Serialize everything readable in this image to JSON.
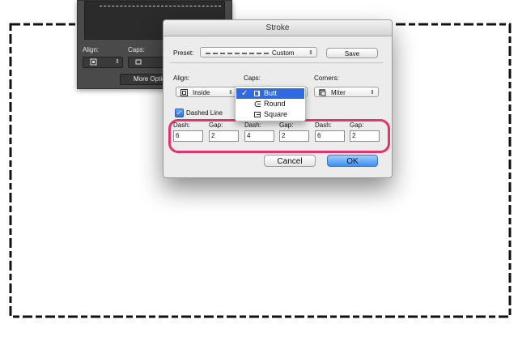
{
  "left_panel": {
    "align_label": "Align:",
    "caps_label": "Caps:",
    "more_options": "More Options"
  },
  "dialog": {
    "title": "Stroke",
    "preset_label": "Preset:",
    "preset_value": "Custom",
    "save_label": "Save",
    "align_label": "Align:",
    "align_value": "Inside",
    "caps_label": "Caps:",
    "corners_label": "Corners:",
    "corners_value": "Miter",
    "dashed_line_label": "Dashed Line",
    "dash_fields": [
      {
        "label": "Dash:",
        "value": "6"
      },
      {
        "label": "Gap:",
        "value": "2"
      },
      {
        "label": "Dash:",
        "value": "4"
      },
      {
        "label": "Gap:",
        "value": "2"
      },
      {
        "label": "Dash:",
        "value": "6"
      },
      {
        "label": "Gap:",
        "value": "2"
      }
    ],
    "cancel_label": "Cancel",
    "ok_label": "OK"
  },
  "caps_menu": {
    "items": [
      {
        "label": "Butt",
        "selected": true,
        "icon": "butt-cap-icon"
      },
      {
        "label": "Round",
        "selected": false,
        "icon": "round-cap-icon"
      },
      {
        "label": "Square",
        "selected": false,
        "icon": "square-cap-icon"
      }
    ]
  },
  "colors": {
    "highlight": "#e6336f",
    "selection": "#2f6ae2",
    "ok_button": "#3d8ff0"
  }
}
